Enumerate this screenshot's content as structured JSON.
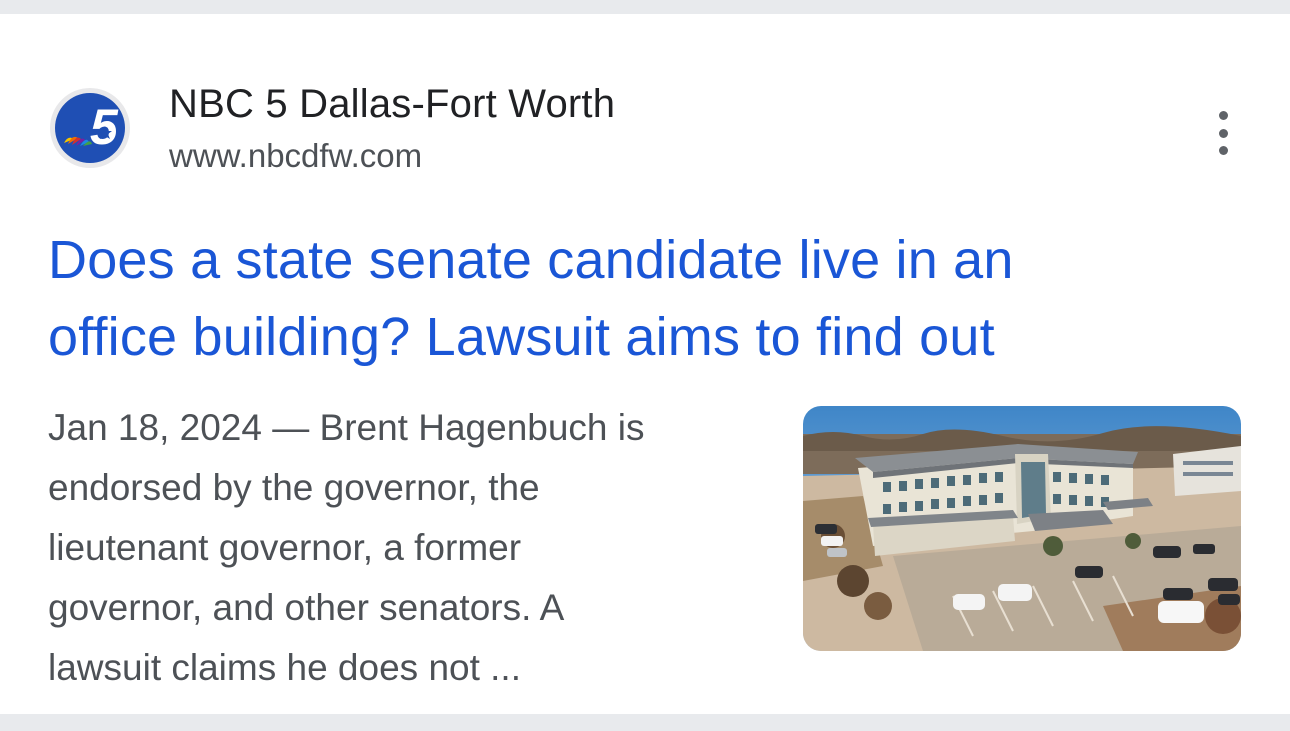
{
  "result": {
    "source": {
      "name": "NBC 5 Dallas-Fort Worth",
      "url": "www.nbcdfw.com",
      "logo_icon": "nbc5-logo-icon",
      "logo_colors": {
        "circle": "#1f4fb4",
        "ring": "#e8e8ea"
      }
    },
    "menu_icon": "more-vert-icon",
    "headline_lines": [
      "Does a state senate candidate live in an",
      "office building? Lawsuit aims to find out"
    ],
    "snippet_lines": [
      "Jan 18, 2024 — Brent Hagenbuch is",
      "endorsed by the governor, the",
      "lieutenant governor, a former",
      "governor, and other senators. A",
      "lawsuit claims he does not ..."
    ],
    "thumbnail_icon": "office-building-photo"
  },
  "colors": {
    "headline": "#1a56d6",
    "snippet": "#4d5156",
    "page_background": "#e8eaed",
    "card_background": "#ffffff"
  }
}
